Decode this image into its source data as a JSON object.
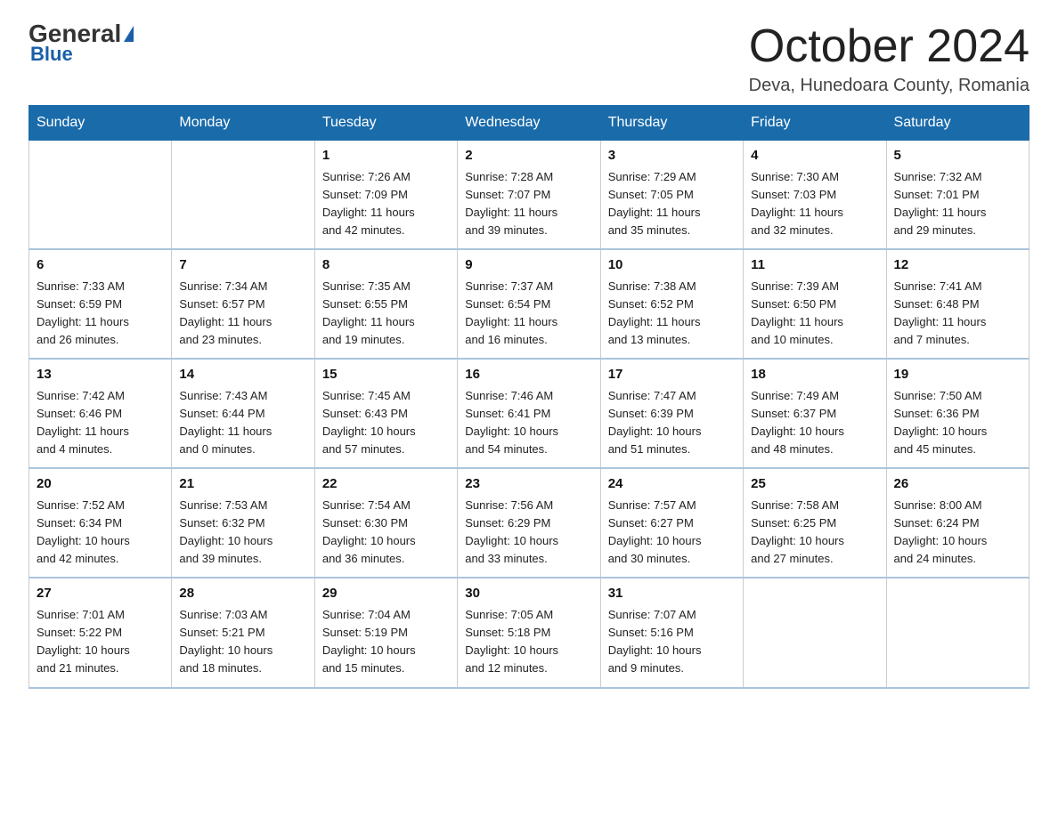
{
  "header": {
    "logo_general": "General",
    "logo_blue": "Blue",
    "month_title": "October 2024",
    "location": "Deva, Hunedoara County, Romania"
  },
  "weekdays": [
    "Sunday",
    "Monday",
    "Tuesday",
    "Wednesday",
    "Thursday",
    "Friday",
    "Saturday"
  ],
  "weeks": [
    [
      {
        "day": "",
        "info": ""
      },
      {
        "day": "",
        "info": ""
      },
      {
        "day": "1",
        "info": "Sunrise: 7:26 AM\nSunset: 7:09 PM\nDaylight: 11 hours\nand 42 minutes."
      },
      {
        "day": "2",
        "info": "Sunrise: 7:28 AM\nSunset: 7:07 PM\nDaylight: 11 hours\nand 39 minutes."
      },
      {
        "day": "3",
        "info": "Sunrise: 7:29 AM\nSunset: 7:05 PM\nDaylight: 11 hours\nand 35 minutes."
      },
      {
        "day": "4",
        "info": "Sunrise: 7:30 AM\nSunset: 7:03 PM\nDaylight: 11 hours\nand 32 minutes."
      },
      {
        "day": "5",
        "info": "Sunrise: 7:32 AM\nSunset: 7:01 PM\nDaylight: 11 hours\nand 29 minutes."
      }
    ],
    [
      {
        "day": "6",
        "info": "Sunrise: 7:33 AM\nSunset: 6:59 PM\nDaylight: 11 hours\nand 26 minutes."
      },
      {
        "day": "7",
        "info": "Sunrise: 7:34 AM\nSunset: 6:57 PM\nDaylight: 11 hours\nand 23 minutes."
      },
      {
        "day": "8",
        "info": "Sunrise: 7:35 AM\nSunset: 6:55 PM\nDaylight: 11 hours\nand 19 minutes."
      },
      {
        "day": "9",
        "info": "Sunrise: 7:37 AM\nSunset: 6:54 PM\nDaylight: 11 hours\nand 16 minutes."
      },
      {
        "day": "10",
        "info": "Sunrise: 7:38 AM\nSunset: 6:52 PM\nDaylight: 11 hours\nand 13 minutes."
      },
      {
        "day": "11",
        "info": "Sunrise: 7:39 AM\nSunset: 6:50 PM\nDaylight: 11 hours\nand 10 minutes."
      },
      {
        "day": "12",
        "info": "Sunrise: 7:41 AM\nSunset: 6:48 PM\nDaylight: 11 hours\nand 7 minutes."
      }
    ],
    [
      {
        "day": "13",
        "info": "Sunrise: 7:42 AM\nSunset: 6:46 PM\nDaylight: 11 hours\nand 4 minutes."
      },
      {
        "day": "14",
        "info": "Sunrise: 7:43 AM\nSunset: 6:44 PM\nDaylight: 11 hours\nand 0 minutes."
      },
      {
        "day": "15",
        "info": "Sunrise: 7:45 AM\nSunset: 6:43 PM\nDaylight: 10 hours\nand 57 minutes."
      },
      {
        "day": "16",
        "info": "Sunrise: 7:46 AM\nSunset: 6:41 PM\nDaylight: 10 hours\nand 54 minutes."
      },
      {
        "day": "17",
        "info": "Sunrise: 7:47 AM\nSunset: 6:39 PM\nDaylight: 10 hours\nand 51 minutes."
      },
      {
        "day": "18",
        "info": "Sunrise: 7:49 AM\nSunset: 6:37 PM\nDaylight: 10 hours\nand 48 minutes."
      },
      {
        "day": "19",
        "info": "Sunrise: 7:50 AM\nSunset: 6:36 PM\nDaylight: 10 hours\nand 45 minutes."
      }
    ],
    [
      {
        "day": "20",
        "info": "Sunrise: 7:52 AM\nSunset: 6:34 PM\nDaylight: 10 hours\nand 42 minutes."
      },
      {
        "day": "21",
        "info": "Sunrise: 7:53 AM\nSunset: 6:32 PM\nDaylight: 10 hours\nand 39 minutes."
      },
      {
        "day": "22",
        "info": "Sunrise: 7:54 AM\nSunset: 6:30 PM\nDaylight: 10 hours\nand 36 minutes."
      },
      {
        "day": "23",
        "info": "Sunrise: 7:56 AM\nSunset: 6:29 PM\nDaylight: 10 hours\nand 33 minutes."
      },
      {
        "day": "24",
        "info": "Sunrise: 7:57 AM\nSunset: 6:27 PM\nDaylight: 10 hours\nand 30 minutes."
      },
      {
        "day": "25",
        "info": "Sunrise: 7:58 AM\nSunset: 6:25 PM\nDaylight: 10 hours\nand 27 minutes."
      },
      {
        "day": "26",
        "info": "Sunrise: 8:00 AM\nSunset: 6:24 PM\nDaylight: 10 hours\nand 24 minutes."
      }
    ],
    [
      {
        "day": "27",
        "info": "Sunrise: 7:01 AM\nSunset: 5:22 PM\nDaylight: 10 hours\nand 21 minutes."
      },
      {
        "day": "28",
        "info": "Sunrise: 7:03 AM\nSunset: 5:21 PM\nDaylight: 10 hours\nand 18 minutes."
      },
      {
        "day": "29",
        "info": "Sunrise: 7:04 AM\nSunset: 5:19 PM\nDaylight: 10 hours\nand 15 minutes."
      },
      {
        "day": "30",
        "info": "Sunrise: 7:05 AM\nSunset: 5:18 PM\nDaylight: 10 hours\nand 12 minutes."
      },
      {
        "day": "31",
        "info": "Sunrise: 7:07 AM\nSunset: 5:16 PM\nDaylight: 10 hours\nand 9 minutes."
      },
      {
        "day": "",
        "info": ""
      },
      {
        "day": "",
        "info": ""
      }
    ]
  ]
}
